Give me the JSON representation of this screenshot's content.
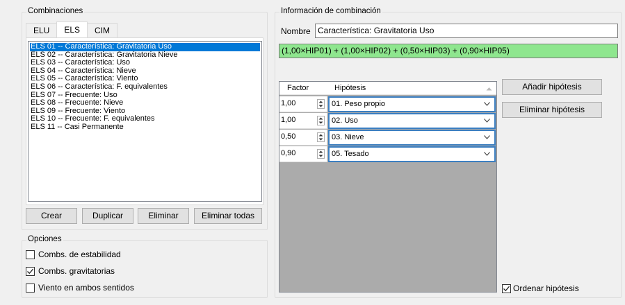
{
  "combinaciones": {
    "title": "Combinaciones",
    "tabs": [
      "ELU",
      "ELS",
      "CIM"
    ],
    "active_tab": "ELS",
    "items": [
      "ELS 01 -- Característica: Gravitatoria Uso",
      "ELS 02 -- Característica: Gravitatoria Nieve",
      "ELS 03 -- Característica: Uso",
      "ELS 04 -- Característica: Nieve",
      "ELS 05 -- Característica: Viento",
      "ELS 06 -- Característica: F. equivalentes",
      "ELS 07 -- Frecuente: Uso",
      "ELS 08 -- Frecuente: Nieve",
      "ELS 09 -- Frecuente: Viento",
      "ELS 10 -- Frecuente: F. equivalentes",
      "ELS 11 -- Casi Permanente"
    ],
    "selected_index": 0,
    "buttons": {
      "crear": "Crear",
      "duplicar": "Duplicar",
      "eliminar": "Eliminar",
      "eliminar_todas": "Eliminar todas"
    }
  },
  "opciones": {
    "title": "Opciones",
    "checks": [
      {
        "label": "Combs. de estabilidad",
        "checked": false
      },
      {
        "label": "Combs. gravitatorias",
        "checked": true
      },
      {
        "label": "Viento en ambos sentidos",
        "checked": false
      }
    ]
  },
  "info": {
    "title": "Información de combinación",
    "nombre_label": "Nombre",
    "nombre_value": "Característica: Gravitatoria Uso",
    "formula": "(1,00×HIP01) + (1,00×HIP02) + (0,50×HIP03) + (0,90×HIP05)",
    "formula_color": "#8ee68e",
    "grid": {
      "col_factor": "Factor",
      "col_hipotesis": "Hipótesis",
      "rows": [
        {
          "factor": "1,00",
          "hipotesis": "01. Peso propio"
        },
        {
          "factor": "1,00",
          "hipotesis": "02. Uso"
        },
        {
          "factor": "0,50",
          "hipotesis": "03. Nieve"
        },
        {
          "factor": "0,90",
          "hipotesis": "05. Tesado"
        }
      ]
    },
    "buttons": {
      "anadir": "Añadir hipótesis",
      "eliminar": "Eliminar hipótesis"
    },
    "ordenar": {
      "label": "Ordenar hipótesis",
      "checked": true
    }
  }
}
